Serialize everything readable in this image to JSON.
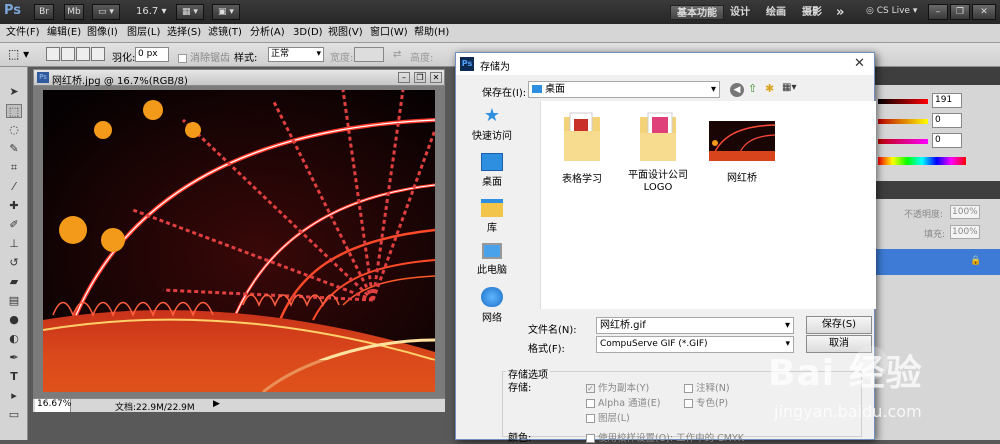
{
  "titlebar": {
    "logo": "Ps",
    "mb": "Mb",
    "zoom": "16.7",
    "workspaces": [
      "基本功能",
      "设计",
      "绘画",
      "摄影"
    ],
    "more": "»",
    "cslive": "CS Live"
  },
  "menu": [
    "文件(F)",
    "编辑(E)",
    "图像(I)",
    "图层(L)",
    "选择(S)",
    "滤镜(T)",
    "分析(A)",
    "3D(D)",
    "视图(V)",
    "窗口(W)",
    "帮助(H)"
  ],
  "options": {
    "feather_label": "羽化:",
    "feather_value": "0 px",
    "antialias_label": "消除锯齿",
    "style_label": "样式:",
    "style_value": "正常",
    "width_label": "宽度:",
    "height_label": "高度:"
  },
  "document": {
    "title": "网红桥.jpg @ 16.7%(RGB/8)",
    "zoom": "16.67%",
    "docinfo": "文档:22.9M/22.9M"
  },
  "rightpanel": {
    "r_value": "191",
    "g_value": "0",
    "b_value": "0",
    "opacity_label": "不透明度:",
    "opacity_value": "100%",
    "fill_label": "填充:",
    "fill_value": "100%"
  },
  "dialog": {
    "title": "存储为",
    "save_in_label": "保存在(I):",
    "save_in_value": "桌面",
    "nav": [
      "快速访问",
      "桌面",
      "库",
      "此电脑",
      "网络"
    ],
    "files": [
      {
        "name": "表格学习"
      },
      {
        "name": "平面设计公司LOGO"
      },
      {
        "name": "网红桥"
      }
    ],
    "filename_label": "文件名(N):",
    "filename_value": "网红桥.gif",
    "format_label": "格式(F):",
    "format_value": "CompuServe GIF (*.GIF)",
    "save_button": "保存(S)",
    "cancel_button": "取消",
    "options_group": "存储选项",
    "save_label": "存储:",
    "as_copy": "作为副本(Y)",
    "notes": "注释(N)",
    "alpha": "Alpha 通道(E)",
    "spot": "专色(P)",
    "layers": "图层(L)",
    "color_label": "颜色:",
    "proof": "使用校样设置(O): 工作中的 CMYK"
  },
  "watermark": {
    "brand": "Bai 经验",
    "url": "jingyan.baidu.com"
  }
}
